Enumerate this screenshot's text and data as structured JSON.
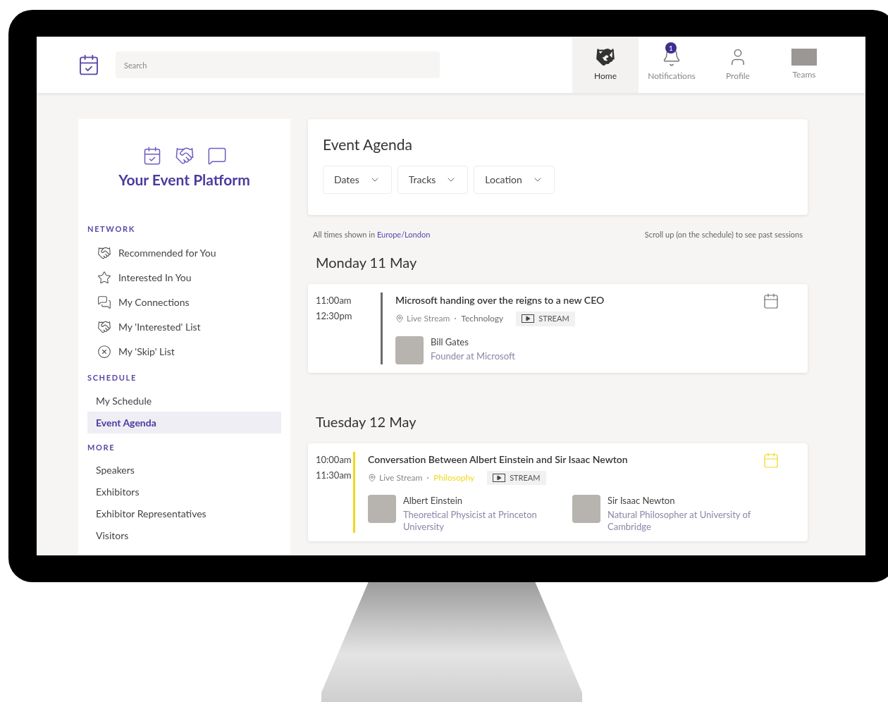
{
  "header": {
    "search": {
      "placeholder": "Search"
    },
    "nav": [
      {
        "label": "Home",
        "kind": "home",
        "selected": true
      },
      {
        "label": "Notifications",
        "kind": "bell",
        "selected": false,
        "badge": "1"
      },
      {
        "label": "Profile",
        "kind": "user",
        "selected": false
      },
      {
        "label": "Teams",
        "kind": "logo",
        "selected": false
      }
    ]
  },
  "sidebar": {
    "title": "Your Event Platform",
    "sections": [
      {
        "heading": "NETWORK",
        "items": [
          {
            "label": "Recommended for You",
            "kind": "handshake",
            "selected": false
          },
          {
            "label": "Interested In You",
            "kind": "star",
            "selected": false
          },
          {
            "label": "My Connections",
            "kind": "chat",
            "selected": false
          },
          {
            "label": "My 'Interested' List",
            "kind": "handshake",
            "selected": false
          },
          {
            "label": "My 'Skip' List",
            "kind": "x",
            "selected": false
          }
        ]
      },
      {
        "heading": "SCHEDULE",
        "items": [
          {
            "label": "My Schedule",
            "selected": false
          },
          {
            "label": "Event Agenda",
            "selected": true
          }
        ]
      },
      {
        "heading": "MORE",
        "items": [
          {
            "label": "Speakers",
            "selected": false
          },
          {
            "label": "Exhibitors",
            "selected": false
          },
          {
            "label": "Exhibitor Representatives",
            "selected": false
          },
          {
            "label": "Visitors",
            "selected": false
          }
        ]
      }
    ]
  },
  "agenda": {
    "title": "Event Agenda",
    "filters": [
      "Dates",
      "Tracks",
      "Location"
    ],
    "timezone_note": "All times shown in",
    "timezone": "Europe/London",
    "scroll_note": "Scroll up (on the schedule) to see past sessions",
    "days": [
      {
        "date": "Monday 11 May",
        "sessions": [
          {
            "start": "11:00am",
            "end": "12:30pm",
            "title": "Microsoft handing over the reigns to a new CEO",
            "location": "Live Stream",
            "track": "Technology",
            "color": "#6b6b6b",
            "badge": "STREAM",
            "speakers": [
              {
                "name": "Bill Gates",
                "role": "Founder at Microsoft"
              }
            ]
          }
        ]
      },
      {
        "date": "Tuesday 12 May",
        "sessions": [
          {
            "start": "10:00am",
            "end": "11:30am",
            "title": "Conversation Between Albert Einstein and Sir Isaac Newton",
            "location": "Live Stream",
            "track": "Philosophy",
            "color": "#f0d81c",
            "badge": "STREAM",
            "speakers": [
              {
                "name": "Albert Einstein",
                "role": "Theoretical Physicist at Princeton University"
              },
              {
                "name": "Sir Isaac Newton",
                "role": "Natural Philosopher at University of Cambridge"
              }
            ]
          }
        ]
      }
    ]
  }
}
